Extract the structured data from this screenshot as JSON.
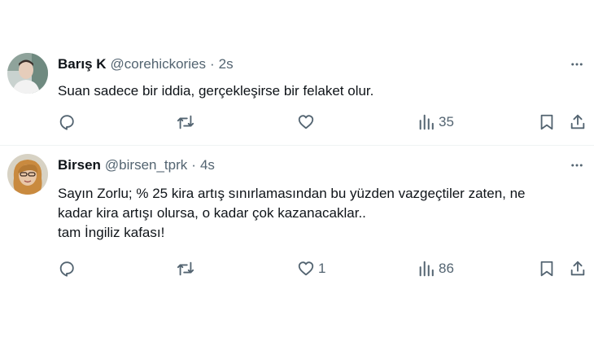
{
  "tweets": [
    {
      "name": "Barış K",
      "handle": "@corehickories",
      "separator": "·",
      "time": "2s",
      "lines": [
        "Suan sadece bir iddia, gerçekleşirse bir felaket olur."
      ],
      "likes": "",
      "views": "35",
      "icons": {
        "reply": "reply-icon",
        "retweet": "retweet-icon",
        "like": "heart-icon",
        "views": "views-bar-chart-icon",
        "bookmark": "bookmark-icon",
        "share": "share-icon",
        "more": "more-icon"
      }
    },
    {
      "name": "Birsen",
      "handle": "@birsen_tprk",
      "separator": "·",
      "time": "4s",
      "lines": [
        "Sayın Zorlu; % 25 kira artış sınırlamasından bu yüzden vazgeçtiler zaten, ne",
        "kadar kira artışı olursa, o kadar çok kazanacaklar..",
        "tam İngiliz kafası!"
      ],
      "likes": "1",
      "views": "86",
      "icons": {
        "reply": "reply-icon",
        "retweet": "retweet-icon",
        "like": "heart-icon",
        "views": "views-bar-chart-icon",
        "bookmark": "bookmark-icon",
        "share": "share-icon",
        "more": "more-icon"
      }
    }
  ],
  "colors": {
    "text": "#0f1419",
    "secondary": "#536471",
    "divider": "#eff3f4"
  }
}
